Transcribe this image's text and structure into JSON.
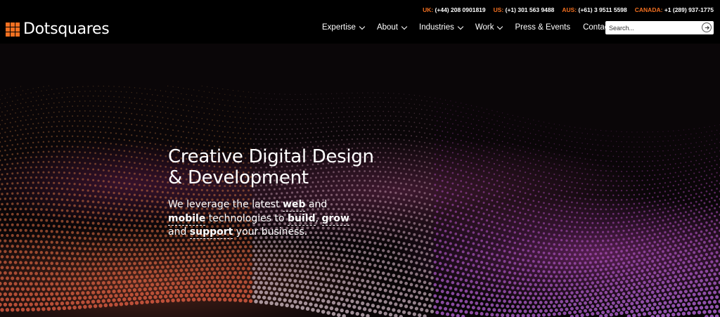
{
  "header": {
    "phones": [
      {
        "label": "UK:",
        "number": "(+44) 208 0901819"
      },
      {
        "label": "US:",
        "number": "(+1) 301 563 9488"
      },
      {
        "label": "AUS:",
        "number": "(+61) 3 9511 5598"
      },
      {
        "label": "CANADA:",
        "number": "+1 (289) 937-1775"
      }
    ],
    "logo_text": "Dotsquares",
    "nav": [
      {
        "label": "Expertise",
        "dropdown": true
      },
      {
        "label": "About",
        "dropdown": true
      },
      {
        "label": "Industries",
        "dropdown": true
      },
      {
        "label": "Work",
        "dropdown": true
      },
      {
        "label": "Press & Events",
        "dropdown": false
      },
      {
        "label": "Contact",
        "dropdown": false
      }
    ],
    "search": {
      "placeholder": "Search...",
      "value": ""
    }
  },
  "hero": {
    "title_line1": "Creative Digital Design",
    "title_line2": "& Development",
    "sub": {
      "t1": "We leverage the latest ",
      "h1": "web",
      "t2": " and ",
      "h2": "mobile",
      "t3": " technologies to ",
      "h3": "build",
      "t4": ", ",
      "h4": "grow",
      "t5": " and ",
      "h5": "support",
      "t6": " your business."
    }
  },
  "colors": {
    "accent": "#f37021",
    "background": "#000000"
  }
}
